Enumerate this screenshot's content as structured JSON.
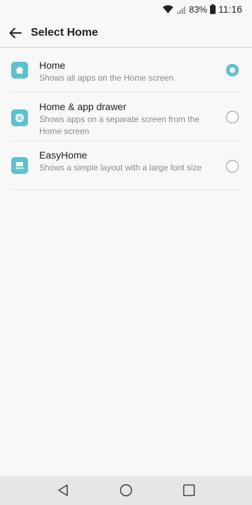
{
  "status_bar": {
    "battery": "83%",
    "time": "11:16",
    "icons": [
      "wifi-icon",
      "signal-icon",
      "battery-icon"
    ]
  },
  "app_bar": {
    "title": "Select Home",
    "back_icon": "arrow-back-icon"
  },
  "options": [
    {
      "title": "Home",
      "description": "Shows all apps on the Home screen",
      "icon": "home-launcher-icon",
      "selected": true
    },
    {
      "title": "Home & app drawer",
      "description": "Shows apps on a separate screen from the Home screen",
      "icon": "app-drawer-launcher-icon",
      "selected": false
    },
    {
      "title": "EasyHome",
      "description": "Shows a simple layout with a large font size",
      "icon": "easyhome-launcher-icon",
      "selected": false
    }
  ],
  "nav_bar": {
    "icons": [
      "back-triangle-icon",
      "home-circle-icon",
      "recents-square-icon"
    ]
  },
  "colors": {
    "accent": "#5cc2cf",
    "background": "#f8f8f8",
    "nav_bar": "#e6e6e6"
  }
}
